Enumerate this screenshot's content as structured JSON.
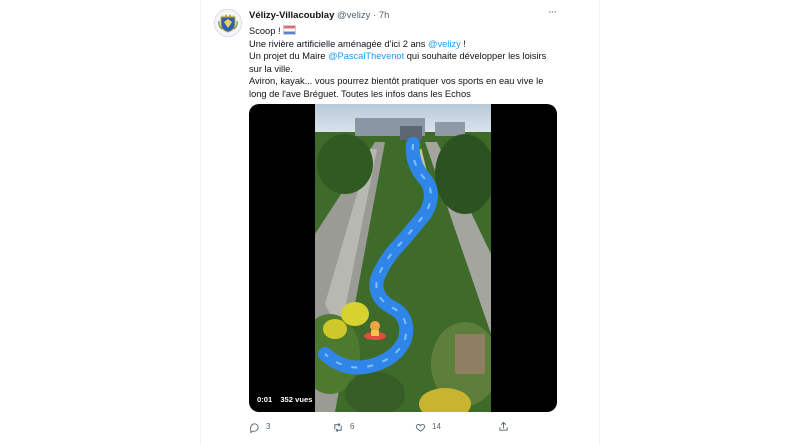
{
  "tweet": {
    "author_name": "Vélizy-Villacoublay",
    "author_handle": "@velizy",
    "separator": "·",
    "time": "7h",
    "more_label": "···",
    "lines": {
      "l1": "Scoop !",
      "l2_pre": "Une rivière artificielle aménagée d'ici 2 ans ",
      "l2_mention": "@velizy",
      "l2_post": " !",
      "l3_pre": "Un projet du Maire ",
      "l3_mention": "@PascalThevenot",
      "l3_post": " qui souhaite développer les loisirs sur la ville.",
      "l4": " Aviron, kayak... vous pourrez bientôt pratiquer vos sports en eau vive le long de l'ave Bréguet. Toutes les infos dans les Echos"
    },
    "flag_colors": [
      "#e56b6b",
      "#ffffff",
      "#5b84c9"
    ]
  },
  "video": {
    "elapsed": "0:01",
    "views": "352 vues"
  },
  "actions": {
    "reply_count": "3",
    "retweet_count": "6",
    "like_count": "14"
  },
  "colors": {
    "accent": "#1d9bf0",
    "text": "#0f1419",
    "secondary": "#536471",
    "river": "#2f86e8"
  },
  "icons": {
    "avatar": "coat-of-arms-icon",
    "reply": "reply-icon",
    "retweet": "retweet-icon",
    "like": "heart-icon",
    "share": "share-icon"
  }
}
